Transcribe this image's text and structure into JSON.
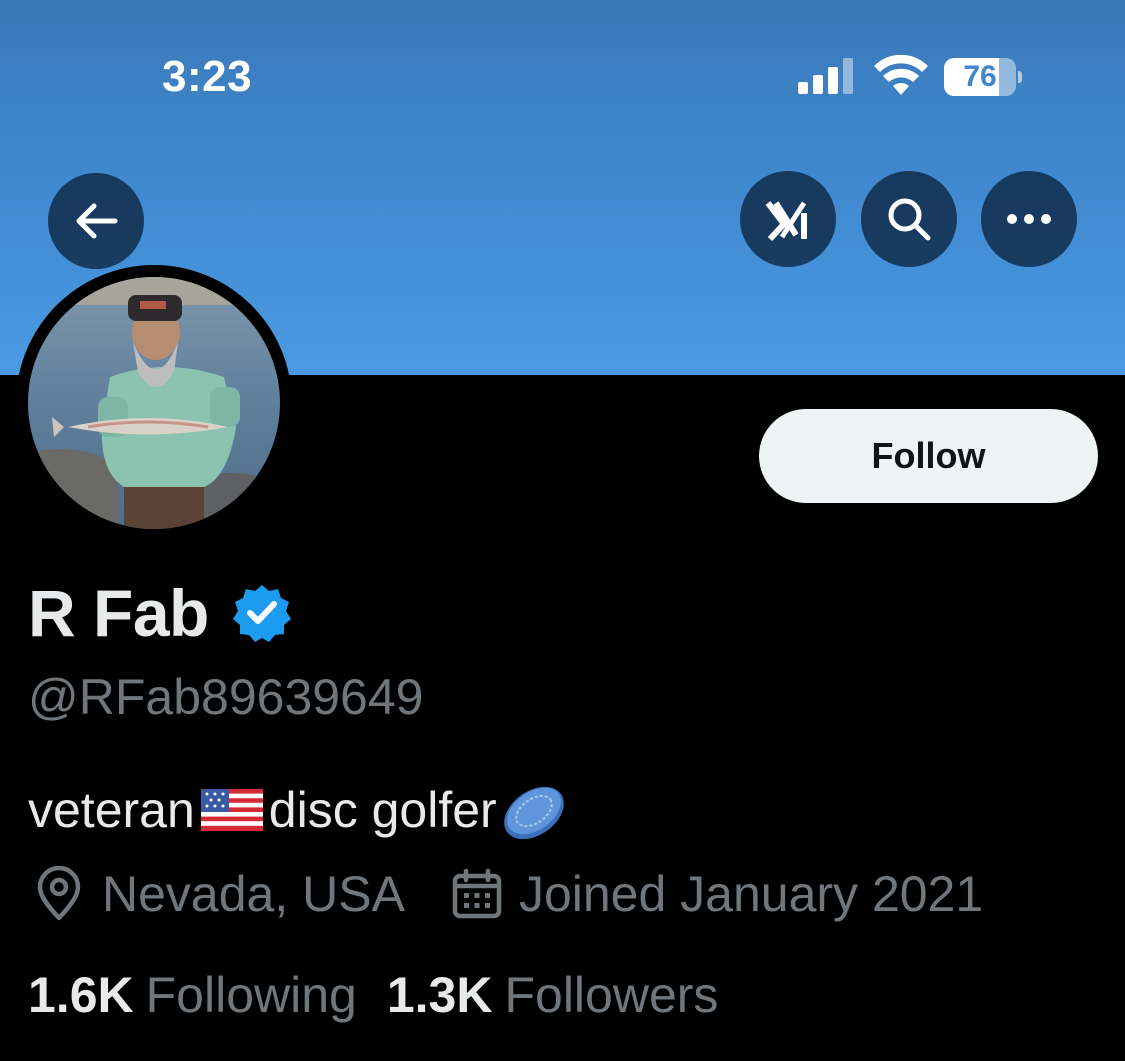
{
  "status_bar": {
    "time": "3:23",
    "battery_level": "76",
    "battery_fraction": 0.76
  },
  "header": {
    "back_icon": "arrow-left-icon",
    "grok_icon": "grok-icon",
    "search_icon": "search-icon",
    "more_icon": "more-horizontal-icon"
  },
  "profile": {
    "display_name": "R Fab",
    "verified": true,
    "verified_color": "#1d9bf0",
    "handle": "@RFab89639649",
    "bio": {
      "part1": "veteran",
      "part2": "disc golfer"
    },
    "location": "Nevada, USA",
    "joined": "Joined January 2021",
    "follow_label": "Follow"
  },
  "stats": {
    "following_count": "1.6K",
    "following_label": "Following",
    "followers_count": "1.3K",
    "followers_label": "Followers"
  },
  "colors": {
    "banner": "#4a9ae3",
    "background": "#000000",
    "primary_text": "#e7e9ea",
    "secondary_text": "#71767b",
    "follow_button": "#eff3f4"
  }
}
